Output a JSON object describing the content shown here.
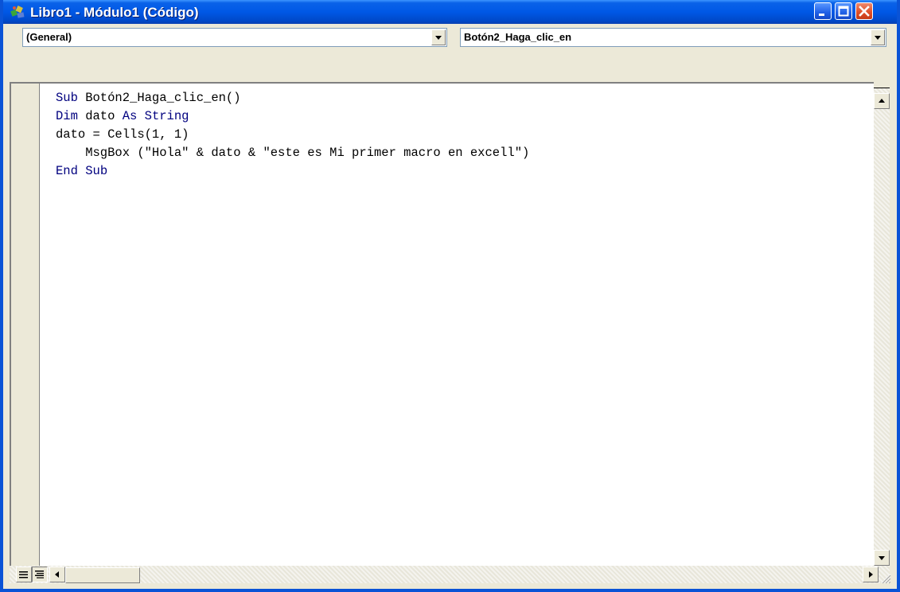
{
  "window": {
    "title": "Libro1 - Módulo1 (Código)",
    "icon": "vba-module-icon",
    "controls": [
      "minimize",
      "maximize",
      "close"
    ]
  },
  "selectors": {
    "object": "(General)",
    "procedure": "Botón2_Haga_clic_en"
  },
  "code_lines": [
    [
      {
        "t": "Sub",
        "kw": true
      },
      {
        "t": " Botón2_Haga_clic_en()",
        "kw": false
      }
    ],
    [
      {
        "t": "Dim",
        "kw": true
      },
      {
        "t": " dato ",
        "kw": false
      },
      {
        "t": "As",
        "kw": true
      },
      {
        "t": " ",
        "kw": false
      },
      {
        "t": "String",
        "kw": true
      }
    ],
    [
      {
        "t": "dato = Cells(1, 1)",
        "kw": false
      }
    ],
    [
      {
        "t": "    MsgBox (\"Hola\" & dato & \"este es Mi primer macro en excell\")",
        "kw": false
      }
    ],
    [
      {
        "t": "End",
        "kw": true
      },
      {
        "t": " ",
        "kw": false
      },
      {
        "t": "Sub",
        "kw": true
      }
    ]
  ],
  "colors": {
    "keyword": "#00007f",
    "titlebar": "#0058e6",
    "chrome": "#ece9d8"
  }
}
